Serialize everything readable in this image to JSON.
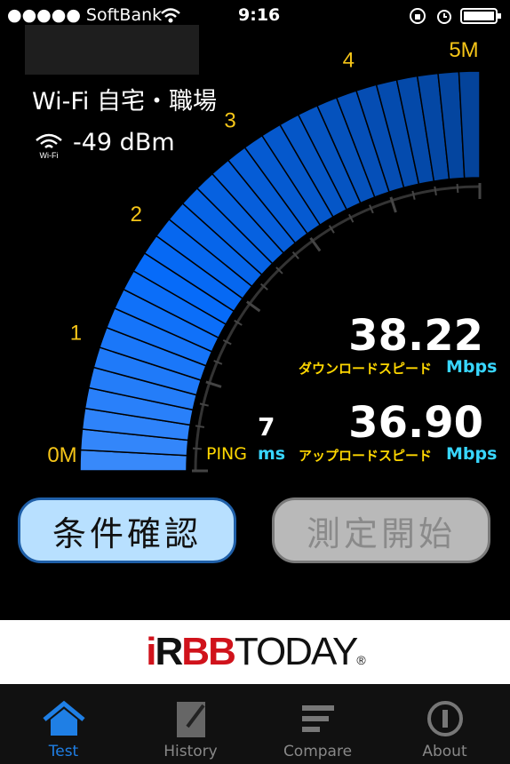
{
  "status": {
    "carrier": "●●●●● SoftBank",
    "time": "9:16"
  },
  "network": {
    "name": "Wi-Fi 自宅・職場",
    "signal": "-49 dBm",
    "wifi_badge": "Wi-Fi"
  },
  "gauge": {
    "scale_labels": [
      "0M",
      "1",
      "2",
      "3",
      "4",
      "5M"
    ],
    "fill_fraction": 1.0,
    "accent": "#1a6cf0"
  },
  "results": {
    "download": {
      "value": "38.22",
      "label": "ダウンロードスピード",
      "unit": "Mbps"
    },
    "upload": {
      "value": "36.90",
      "label": "アップロードスピード",
      "unit": "Mbps"
    },
    "ping": {
      "value": "7",
      "label": "PING",
      "unit": "ms"
    }
  },
  "buttons": {
    "conditions": "条件確認",
    "start": "測定開始"
  },
  "banner": {
    "logo_i": "i",
    "logo_r": "R",
    "logo_bb": "BB",
    "logo_today": "TODAY",
    "logo_reg": "®"
  },
  "tabs": [
    {
      "label": "Test",
      "icon": "home-icon",
      "active": true
    },
    {
      "label": "History",
      "icon": "notepad-icon",
      "active": false
    },
    {
      "label": "Compare",
      "icon": "bars-icon",
      "active": false
    },
    {
      "label": "About",
      "icon": "info-icon",
      "active": false
    }
  ]
}
